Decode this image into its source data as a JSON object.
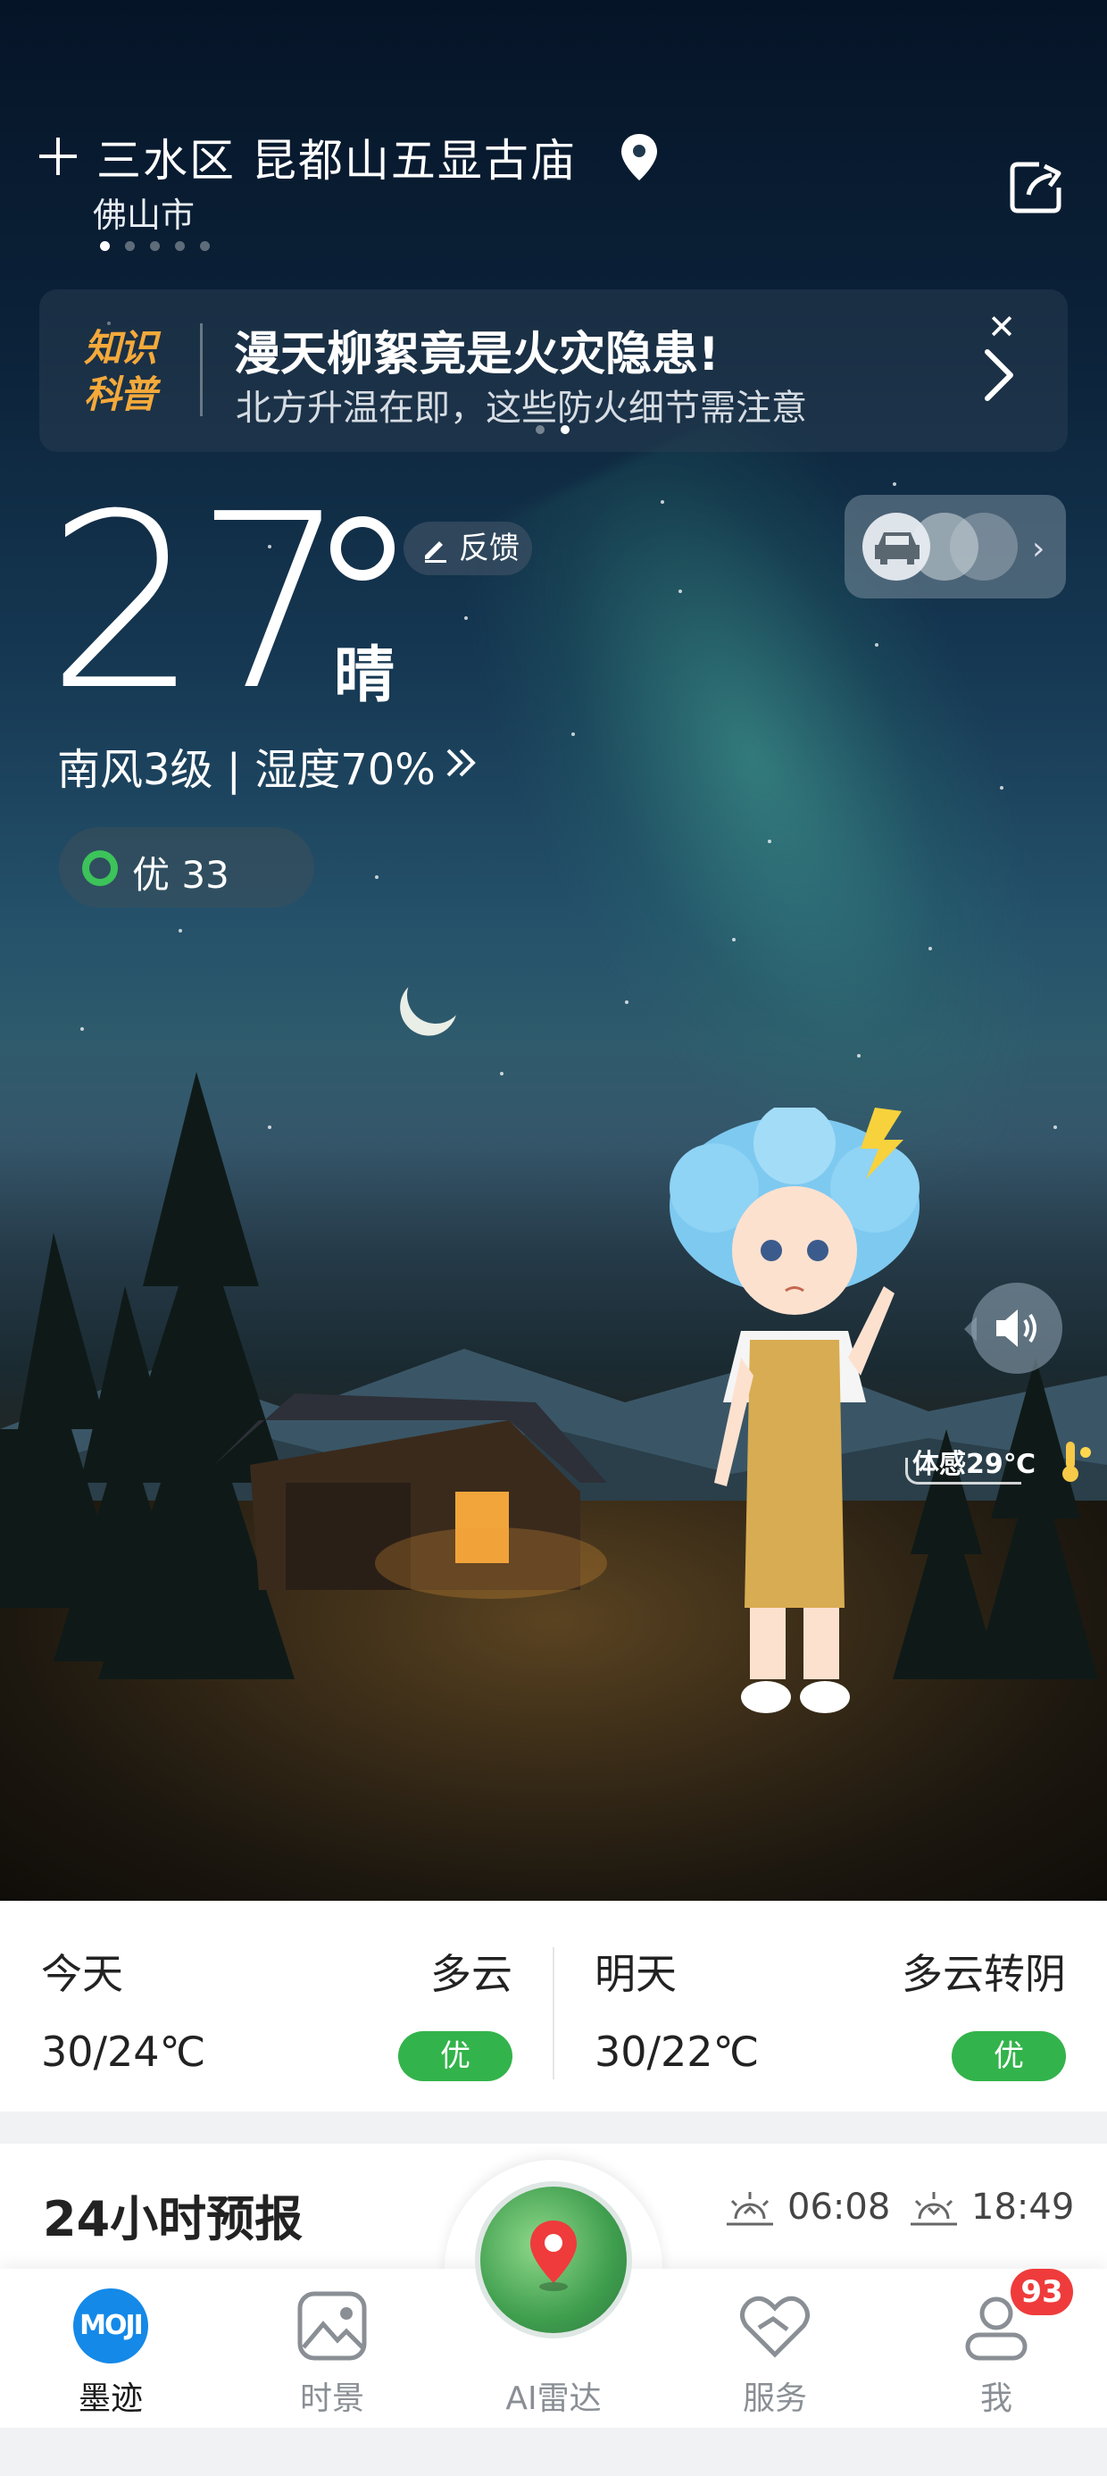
{
  "header": {
    "location": "三水区 昆都山五显古庙",
    "city": "佛山市",
    "page_count": 5,
    "active_page": 1
  },
  "banner": {
    "logo_line1": "知识",
    "logo_line2": "科普",
    "title": "漫天柳絮竟是火灾隐患!",
    "subtitle": "北方升温在即，这些防火细节需注意",
    "close_symbol": "✕"
  },
  "current": {
    "temperature": "27",
    "condition": "晴",
    "feedback_label": "反馈",
    "wind_humidity": "南风3级 | 湿度70%",
    "aqi_label": "优 33",
    "feels_like": "体感29℃"
  },
  "forecast": {
    "today": {
      "label": "今天",
      "weather": "多云",
      "range": "30/24℃",
      "aqi": "优"
    },
    "tomorrow": {
      "label": "明天",
      "weather": "多云转阴",
      "range": "30/22℃",
      "aqi": "优"
    }
  },
  "hourly": {
    "title": "24小时预报",
    "sunrise": "06:08",
    "sunset": "18:49"
  },
  "tabs": [
    {
      "label": "墨迹",
      "icon": "moji-logo-icon",
      "icon_text": "MOJI"
    },
    {
      "label": "时景",
      "icon": "photo-icon"
    },
    {
      "label": "AI雷达",
      "icon": "radar-map-icon"
    },
    {
      "label": "服务",
      "icon": "heart-service-icon"
    },
    {
      "label": "我",
      "icon": "user-icon",
      "badge": "93"
    }
  ],
  "colors": {
    "accent": "#1489e8",
    "aqi_good": "#33b34b",
    "badge_red": "#ef3b3b",
    "banner_logo": "#f4a93a"
  }
}
